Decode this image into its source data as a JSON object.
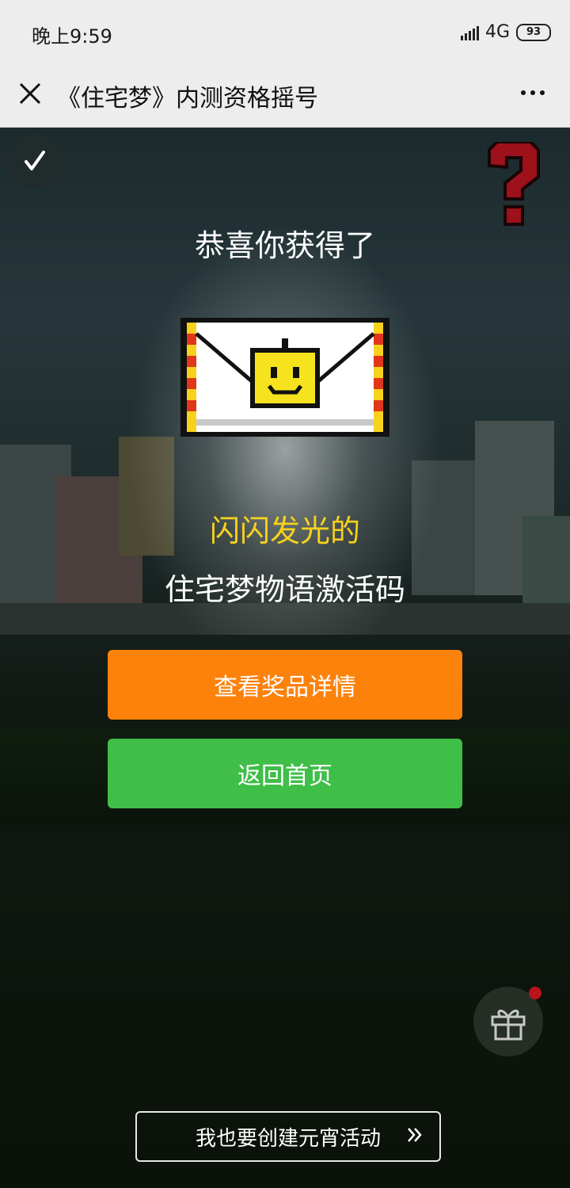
{
  "status_bar": {
    "time": "晚上9:59",
    "network": "4G",
    "battery": "93"
  },
  "nav": {
    "title": "《住宅梦》内测资格摇号"
  },
  "result": {
    "congrats": "恭喜你获得了",
    "prize_line1": "闪闪发光的",
    "prize_line2": "住宅梦物语激活码"
  },
  "buttons": {
    "view_prize": "查看奖品详情",
    "back_home": "返回首页",
    "create_activity": "我也要创建元宵活动"
  },
  "icons": {
    "close": "close-icon",
    "more": "more-icon",
    "music": "music-icon",
    "help": "question-mark-icon",
    "gift": "gift-icon",
    "forward": "double-chevron-right-icon"
  },
  "colors": {
    "orange_button": "#fd820b",
    "green_button": "#3fbe48",
    "highlight_text": "#f6d21d"
  }
}
